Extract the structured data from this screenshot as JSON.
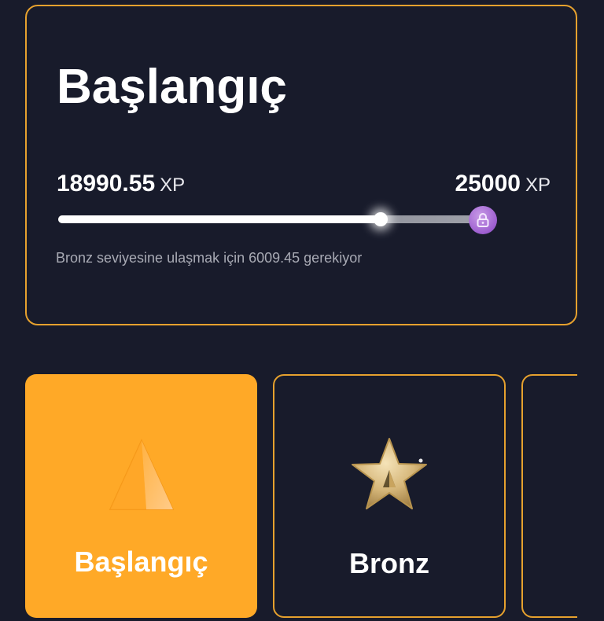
{
  "progress": {
    "level_title": "Başlangıç",
    "current_xp": "18990.55",
    "target_xp": "25000",
    "xp_unit": "XP",
    "fill_fraction": 0.76,
    "requirement_text": "Bronz seviyesine ulaşmak için 6009.45 gerekiyor",
    "lock_icon": "lock-icon"
  },
  "tiers": [
    {
      "label": "Başlangıç",
      "icon": "triangle-icon",
      "state": "active"
    },
    {
      "label": "Bronz",
      "icon": "star-icon",
      "state": "locked"
    }
  ],
  "colors": {
    "background": "#181b2b",
    "accent": "#ffa927",
    "border": "#e6a12e",
    "lock": "#9d5ed0"
  }
}
